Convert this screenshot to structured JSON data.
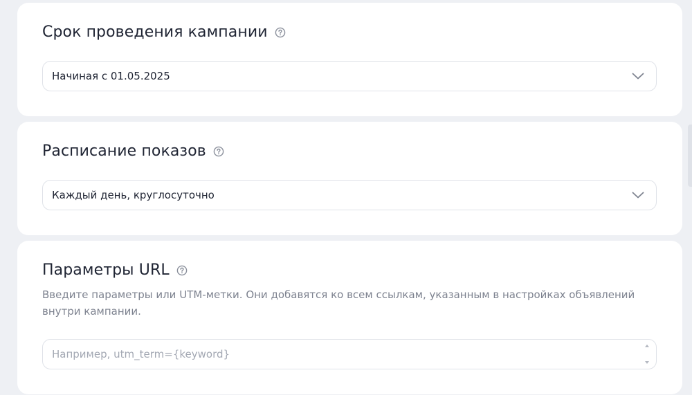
{
  "duration": {
    "title": "Срок проведения кампании",
    "value": "Начиная с 01.05.2025"
  },
  "schedule": {
    "title": "Расписание показов",
    "value": "Каждый день, круглосуточно"
  },
  "url_params": {
    "title": "Параметры URL",
    "description": "Введите параметры или UTM-метки. Они добавятся ко всем ссылкам, указанным в настройках объявлений внутри кампании.",
    "value": "",
    "placeholder": "Например, utm_term={keyword}"
  },
  "colors": {
    "background": "#eef0f4",
    "card": "#ffffff",
    "text": "#1f2433",
    "muted": "#7d828f",
    "border": "#dfe2e8"
  },
  "icons": [
    "help-circle-icon",
    "chevron-down-icon",
    "spin-arrows-icon"
  ]
}
